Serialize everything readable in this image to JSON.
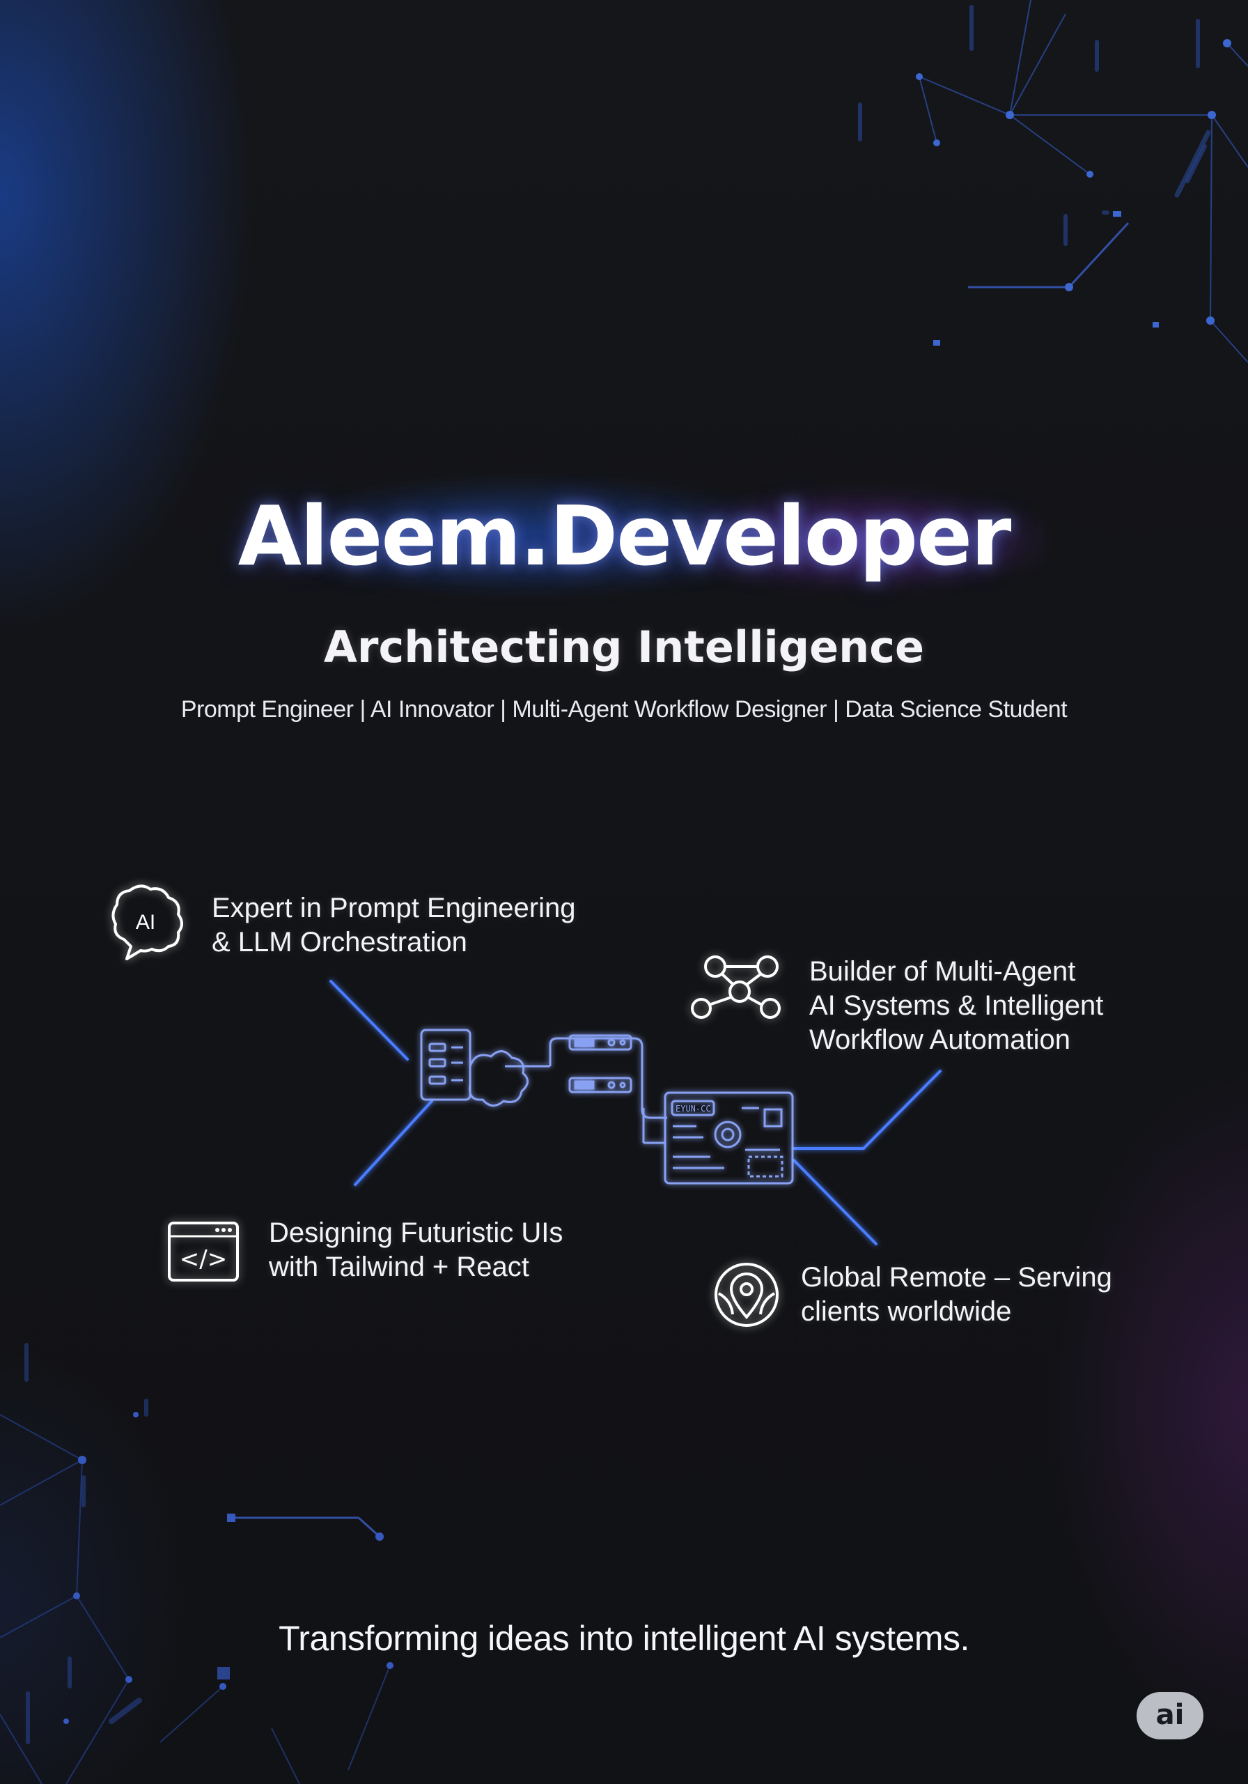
{
  "hero": {
    "title": "Aleem.Developer",
    "tagline": "Architecting Intelligence",
    "roles": "Prompt Engineer | AI Innovator | Multi-Agent Workflow Designer | Data Science Student"
  },
  "features": [
    {
      "icon": "brain-chat-icon",
      "icon_text": "AI",
      "lines": [
        "Expert in Prompt Engineering",
        "& LLM Orchestration"
      ]
    },
    {
      "icon": "network-nodes-icon",
      "lines": [
        "Builder of Multi-Agent",
        "AI Systems & Intelligent",
        "Workflow Automation"
      ]
    },
    {
      "icon": "code-window-icon",
      "icon_text": "</>",
      "lines": [
        "Designing Futuristic UIs",
        "with Tailwind + React"
      ]
    },
    {
      "icon": "map-pin-globe-icon",
      "lines": [
        "Global Remote – Serving",
        "clients worldwide"
      ]
    }
  ],
  "diagram": {
    "panel_label": "EYUN-CC"
  },
  "footer": {
    "text": "Transforming ideas into intelligent AI systems."
  },
  "badge": {
    "label": "ai"
  },
  "colors": {
    "background": "#121316",
    "accent_blue": "#2f6bff",
    "accent_purple": "#9b3df0",
    "line_blue": "#4a7dff"
  }
}
